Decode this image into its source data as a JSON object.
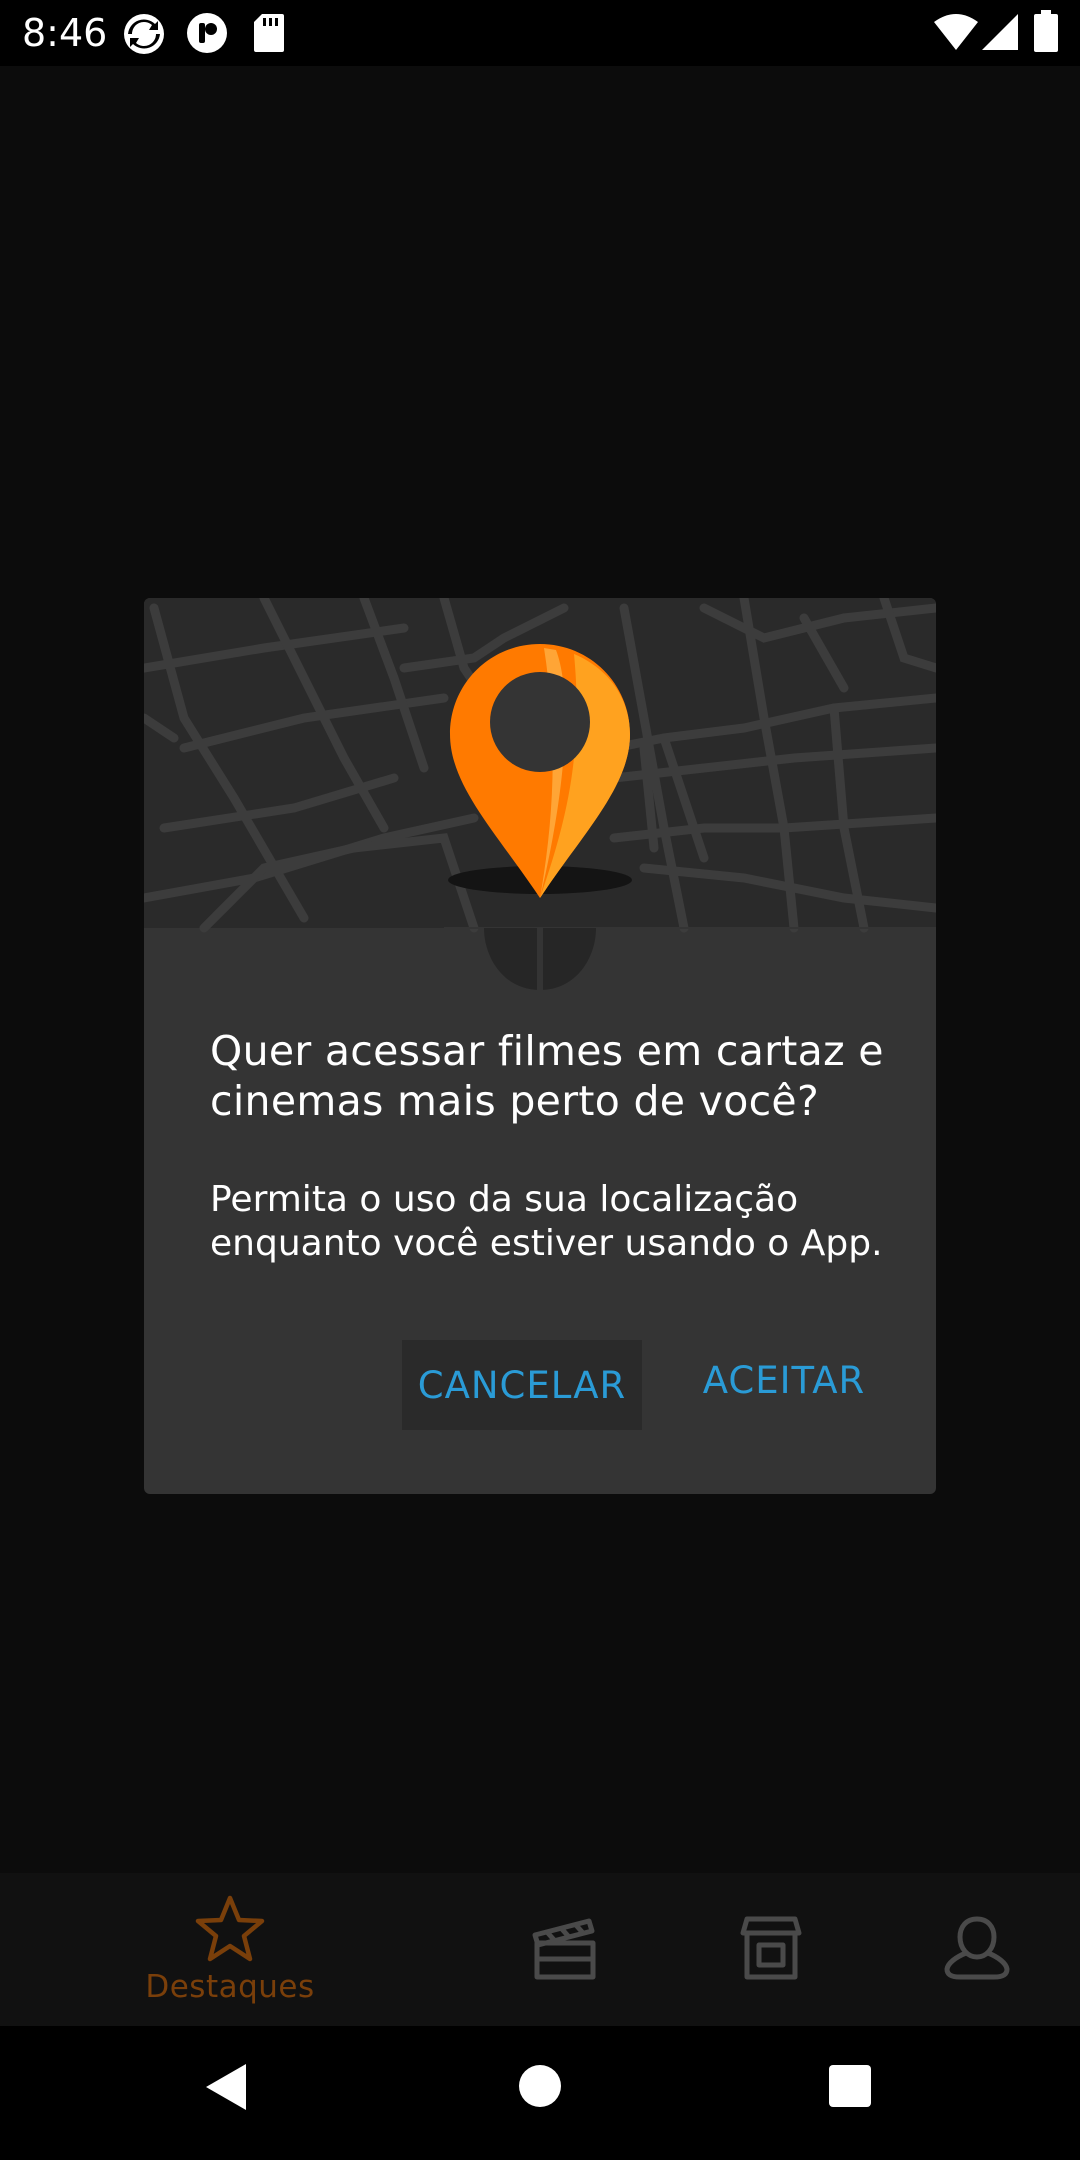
{
  "status_bar": {
    "time": "8:46",
    "icons": [
      "sync-icon",
      "app-icon",
      "sd-card-icon",
      "wifi-icon",
      "signal-icon",
      "battery-icon"
    ]
  },
  "dialog": {
    "title": "Quer acessar filmes em cartaz e cinemas mais perto de você?",
    "message": "Permita o uso da sua localização enquanto você estiver usando o App.",
    "cancel_label": "CANCELAR",
    "accept_label": "ACEITAR",
    "pin_colors": {
      "outer": "#ff7a00",
      "inner": "#ff9a1a",
      "hole": "#343434"
    }
  },
  "bottom_nav": {
    "items": [
      {
        "label": "Destaques",
        "icon": "star-icon",
        "active": true
      },
      {
        "label": "",
        "icon": "clapperboard-icon",
        "active": false
      },
      {
        "label": "",
        "icon": "cinema-building-icon",
        "active": false
      },
      {
        "label": "",
        "icon": "profile-icon",
        "active": false
      }
    ],
    "active_color": "#7a3f0a",
    "inactive_color": "#4a4a4a"
  },
  "system_nav": {
    "buttons": [
      "back-icon",
      "home-icon",
      "recents-icon"
    ]
  }
}
